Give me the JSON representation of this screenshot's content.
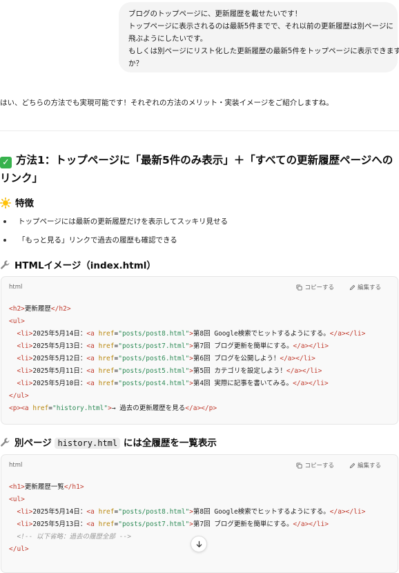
{
  "user_message": {
    "lines": [
      "ブログのトップページに、更新履歴を載せたいです！",
      "トップページに表示されるのは最新5件までで、それ以前の更新履歴は別ページに",
      "飛ぶようにしたいです。",
      "もしくは別ページにリスト化した更新履歴の最新5件をトップページに表示できます",
      "か？"
    ]
  },
  "assistant": {
    "intro": "はい、どちらの方法でも実現可能です！それぞれの方法のメリット・実装イメージをご紹介しますね。",
    "method1_title": "方法1：トップページに「最新5件のみ表示」＋「すべての更新履歴ページへのリンク」",
    "features_heading": "特徴",
    "features": [
      "トップページには最新の更新履歴だけを表示してスッキリ見せる",
      "「もっと見る」リンクで過去の履歴も確認できる"
    ],
    "html_image_heading": "HTMLイメージ（index.html）",
    "code1": {
      "lang": "html",
      "copy_label": "コピーする",
      "edit_label": "編集する",
      "lines": [
        "<h2>更新履歴</h2>",
        "<ul>",
        "  <li>2025年5月14日：<a href=\"posts/post8.html\">第8回 Google検索でヒットするようにする。</a></li>",
        "  <li>2025年5月13日：<a href=\"posts/post7.html\">第7回 ブログ更新を簡単にする。</a></li>",
        "  <li>2025年5月12日：<a href=\"posts/post6.html\">第6回 ブログを公開しよう！</a></li>",
        "  <li>2025年5月11日：<a href=\"posts/post5.html\">第5回 カテゴリを設定しよう！</a></li>",
        "  <li>2025年5月10日：<a href=\"posts/post4.html\">第4回 実際に記事を書いてみる。</a></li>",
        "</ul>",
        "<p><a href=\"history.html\">→ 過去の更新履歴を見る</a></p>"
      ]
    },
    "separate_page_heading_prefix": "別ページ",
    "separate_page_heading_code": "history.html",
    "separate_page_heading_suffix": "には全履歴を一覧表示",
    "code2": {
      "lang": "html",
      "copy_label": "コピーする",
      "edit_label": "編集する",
      "lines": [
        "<h1>更新履歴一覧</h1>",
        "<ul>",
        "  <li>2025年5月14日：<a href=\"posts/post8.html\">第8回 Google検索でヒットするようにする。</a></li>",
        "  <li>2025年5月13日：<a href=\"posts/post7.html\">第7回 ブログ更新を簡単にする。</a></li>",
        "  <!-- 以下省略：過去の履歴全部 -->",
        "</ul>"
      ]
    }
  },
  "colors": {
    "tag": "#c0392b",
    "attr": "#b8860b",
    "string": "#2e8b57",
    "comment": "#9a9a9a",
    "check": "#37b24d"
  },
  "icons": {
    "method_icon": "check-mark-button-icon",
    "features_icon": "sun-icon",
    "code_heading_icon": "wrench-icon",
    "copy_icon": "copy-icon",
    "edit_icon": "pencil-icon",
    "scroll_icon": "arrow-down-icon"
  }
}
